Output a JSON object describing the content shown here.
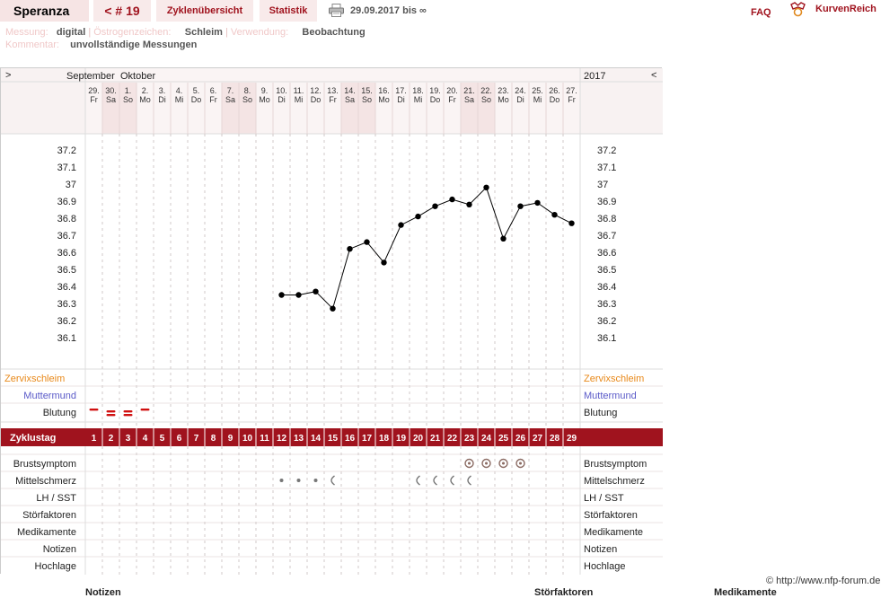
{
  "nav": {
    "user": "Speranza",
    "cycle": "< # 19",
    "overview": "Zyklenübersicht",
    "stats": "Statistik",
    "date_range": "29.09.2017 bis ∞",
    "faq": "FAQ",
    "brand": "KurvenReich"
  },
  "meta": {
    "measurement_label": "Messung:",
    "measurement_value": "digital",
    "estrogen_label": "Östrogenzeichen:",
    "estrogen_value": "Schleim",
    "usage_label": "Verwendung:",
    "usage_value": "Beobachtung",
    "comment_label": "Kommentar:",
    "comment_value": "unvollständige Messungen"
  },
  "chart": {
    "nav_prev": ">",
    "nav_next": "<",
    "months": [
      "September",
      "Oktober"
    ],
    "year": "2017",
    "days": [
      {
        "date": "29.",
        "wd": "Fr",
        "weekend": false
      },
      {
        "date": "30.",
        "wd": "Sa",
        "weekend": true
      },
      {
        "date": "1.",
        "wd": "So",
        "weekend": true
      },
      {
        "date": "2.",
        "wd": "Mo",
        "weekend": false
      },
      {
        "date": "3.",
        "wd": "Di",
        "weekend": false
      },
      {
        "date": "4.",
        "wd": "Mi",
        "weekend": false
      },
      {
        "date": "5.",
        "wd": "Do",
        "weekend": false
      },
      {
        "date": "6.",
        "wd": "Fr",
        "weekend": false
      },
      {
        "date": "7.",
        "wd": "Sa",
        "weekend": true
      },
      {
        "date": "8.",
        "wd": "So",
        "weekend": true
      },
      {
        "date": "9.",
        "wd": "Mo",
        "weekend": false
      },
      {
        "date": "10.",
        "wd": "Di",
        "weekend": false
      },
      {
        "date": "11.",
        "wd": "Mi",
        "weekend": false
      },
      {
        "date": "12.",
        "wd": "Do",
        "weekend": false
      },
      {
        "date": "13.",
        "wd": "Fr",
        "weekend": false
      },
      {
        "date": "14.",
        "wd": "Sa",
        "weekend": true
      },
      {
        "date": "15.",
        "wd": "So",
        "weekend": true
      },
      {
        "date": "16.",
        "wd": "Mo",
        "weekend": false
      },
      {
        "date": "17.",
        "wd": "Di",
        "weekend": false
      },
      {
        "date": "18.",
        "wd": "Mi",
        "weekend": false
      },
      {
        "date": "19.",
        "wd": "Do",
        "weekend": false
      },
      {
        "date": "20.",
        "wd": "Fr",
        "weekend": false
      },
      {
        "date": "21.",
        "wd": "Sa",
        "weekend": true
      },
      {
        "date": "22.",
        "wd": "So",
        "weekend": true
      },
      {
        "date": "23.",
        "wd": "Mo",
        "weekend": false
      },
      {
        "date": "24.",
        "wd": "Di",
        "weekend": false
      },
      {
        "date": "25.",
        "wd": "Mi",
        "weekend": false
      },
      {
        "date": "26.",
        "wd": "Do",
        "weekend": false
      },
      {
        "date": "27.",
        "wd": "Fr",
        "weekend": false
      }
    ],
    "y_ticks": [
      "37.2",
      "37.1",
      "37",
      "36.9",
      "36.8",
      "36.7",
      "36.6",
      "36.5",
      "36.4",
      "36.3",
      "36.2",
      "36.1"
    ],
    "rows": {
      "zervix": "Zervixschleim",
      "muttermund": "Muttermund",
      "blutung": "Blutung",
      "zyklustag": "Zyklustag",
      "brust": "Brustsymptom",
      "mittel": "Mittelschmerz",
      "lh": "LH / SST",
      "stoer": "Störfaktoren",
      "medi": "Medikamente",
      "notiz": "Notizen",
      "hoch": "Hochlage"
    },
    "bleeding_days": [
      1,
      2,
      3,
      4
    ],
    "bleeding_intensity": [
      1,
      2,
      2,
      1
    ],
    "breast_days": [
      23,
      24,
      25,
      26
    ],
    "midpain_dot_days": [
      12,
      13,
      14
    ],
    "midpain_crescent_days": [
      15,
      20,
      21,
      22,
      23
    ],
    "colors": {
      "brand": "#a0131e",
      "weekend": "#f4e4e4",
      "cervix_label": "#e8891a",
      "cervix_os_label": "#5a5ac8",
      "bleeding": "#d01010",
      "symptom": "#8b6b63"
    }
  },
  "chart_data": {
    "type": "line",
    "title": "",
    "xlabel": "Zyklustag",
    "ylabel": "",
    "x": [
      12,
      13,
      14,
      15,
      16,
      17,
      18,
      19,
      20,
      21,
      22,
      23,
      24,
      25,
      26,
      27,
      28,
      29
    ],
    "series": [
      {
        "name": "",
        "values": [
          36.35,
          36.35,
          36.37,
          36.27,
          36.62,
          36.66,
          36.54,
          36.76,
          36.81,
          36.87,
          36.91,
          36.88,
          36.98,
          36.68,
          36.87,
          36.89,
          36.82,
          36.77
        ]
      }
    ],
    "ylim": [
      36.0,
      37.3
    ],
    "grid": true
  },
  "footer": {
    "copyright": "© http://www.nfp-forum.de",
    "col1": "Notizen",
    "col2": "Störfaktoren",
    "col3": "Medikamente"
  }
}
